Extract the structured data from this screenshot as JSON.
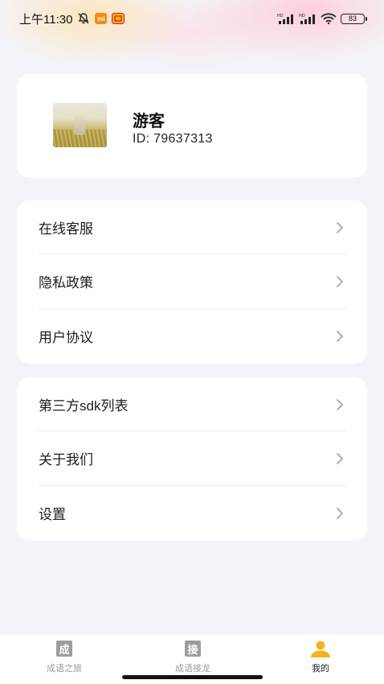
{
  "status_bar": {
    "time": "上午11:30",
    "mi_badge": "mi",
    "battery": "83"
  },
  "profile": {
    "name": "游客",
    "id_text": "ID: 79637313"
  },
  "menu_group_1": {
    "items": [
      {
        "label": "在线客服"
      },
      {
        "label": "隐私政策"
      },
      {
        "label": "用户协议"
      }
    ]
  },
  "menu_group_2": {
    "items": [
      {
        "label": "第三方sdk列表"
      },
      {
        "label": "关于我们"
      },
      {
        "label": "设置"
      }
    ]
  },
  "tabbar": {
    "tabs": [
      {
        "label": "成语之旅",
        "glyph": "成"
      },
      {
        "label": "成语接龙",
        "glyph": "接"
      },
      {
        "label": "我的"
      }
    ],
    "active_index": 2
  },
  "colors": {
    "accent": "#f7b21f",
    "background": "#f3f4f9",
    "card": "#ffffff",
    "tab_inactive": "#9b9b9b"
  }
}
